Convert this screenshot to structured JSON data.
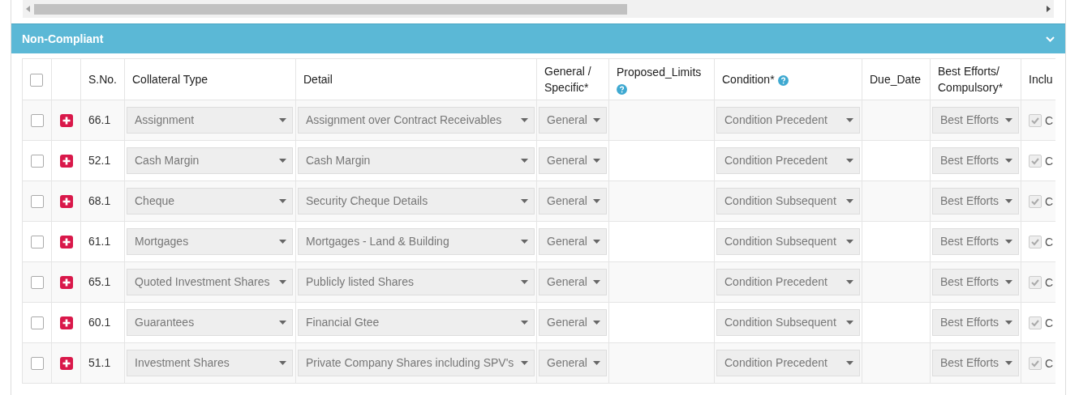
{
  "panel": {
    "title": "Non-Compliant",
    "expanded": true
  },
  "table": {
    "columns": [
      {
        "kind": "check",
        "selected": false
      },
      {
        "kind": "blank"
      },
      {
        "kind": "text",
        "label": "S.No."
      },
      {
        "kind": "text",
        "label": "Collateral Type"
      },
      {
        "kind": "text",
        "label": "Detail"
      },
      {
        "kind": "text",
        "label": "General / Specific*"
      },
      {
        "kind": "help_below",
        "label": "Proposed_Limits"
      },
      {
        "kind": "help_inline",
        "label": "Condition*"
      },
      {
        "kind": "text",
        "label": "Due_Date"
      },
      {
        "kind": "text",
        "label": "Best Efforts/ Compulsory*"
      },
      {
        "kind": "text",
        "label": "Inclu"
      }
    ],
    "rows": [
      {
        "selected": false,
        "sno": "66.1",
        "collateral_type": "Assignment",
        "detail": "Assignment over Contract Receivables",
        "general_specific": "General",
        "condition": "Condition Precedent",
        "best_efforts": "Best Efforts",
        "include_checked": true,
        "include_label": "C"
      },
      {
        "selected": false,
        "sno": "52.1",
        "collateral_type": "Cash Margin",
        "detail": "Cash Margin",
        "general_specific": "General",
        "condition": "Condition Precedent",
        "best_efforts": "Best Efforts",
        "include_checked": true,
        "include_label": "C"
      },
      {
        "selected": false,
        "sno": "68.1",
        "collateral_type": "Cheque",
        "detail": "Security Cheque Details",
        "general_specific": "General",
        "condition": "Condition Subsequent",
        "best_efforts": "Best Efforts",
        "include_checked": true,
        "include_label": "C"
      },
      {
        "selected": false,
        "sno": "61.1",
        "collateral_type": "Mortgages",
        "detail": "Mortgages - Land & Building",
        "general_specific": "General",
        "condition": "Condition Subsequent",
        "best_efforts": "Best Efforts",
        "include_checked": true,
        "include_label": "C"
      },
      {
        "selected": false,
        "sno": "65.1",
        "collateral_type": "Quoted Investment Shares",
        "detail": "Publicly listed Shares",
        "general_specific": "General",
        "condition": "Condition Precedent",
        "best_efforts": "Best Efforts",
        "include_checked": true,
        "include_label": "C"
      },
      {
        "selected": false,
        "sno": "60.1",
        "collateral_type": "Guarantees",
        "detail": "Financial Gtee",
        "general_specific": "General",
        "condition": "Condition Subsequent",
        "best_efforts": "Best Efforts",
        "include_checked": true,
        "include_label": "C"
      },
      {
        "selected": false,
        "sno": "51.1",
        "collateral_type": "Investment Shares",
        "detail": "Private Company Shares including SPV's",
        "general_specific": "General",
        "condition": "Condition Precedent",
        "best_efforts": "Best Efforts",
        "include_checked": true,
        "include_label": "C"
      }
    ]
  }
}
